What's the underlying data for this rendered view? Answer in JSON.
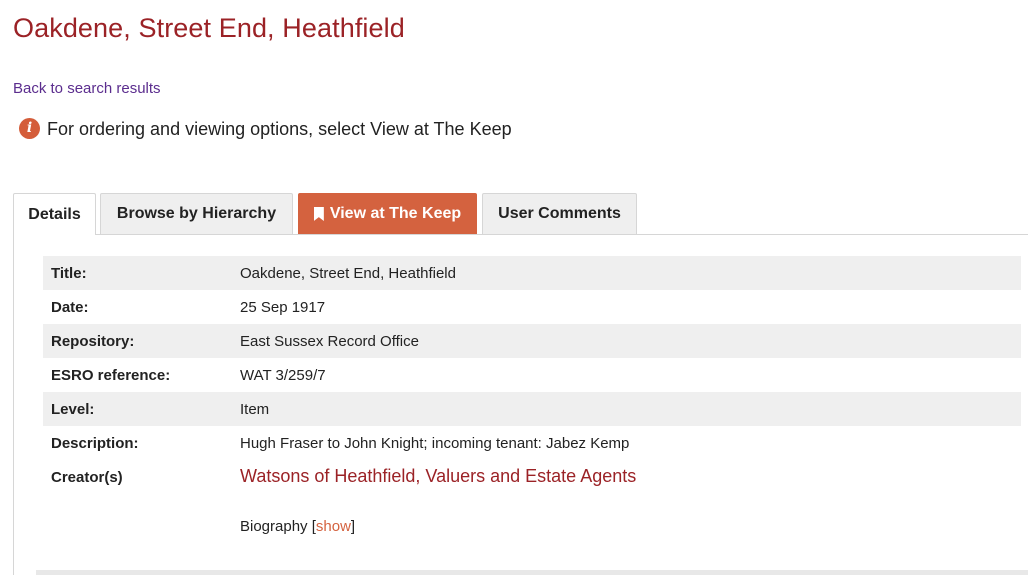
{
  "title": "Oakdene, Street End, Heathfield",
  "back_link": "Back to search results",
  "info": {
    "text": "For ordering and viewing options, select View at The Keep",
    "icon": "info-icon",
    "icon_color": "#d45d3a"
  },
  "tabs": [
    {
      "label": "Details",
      "active": true
    },
    {
      "label": "Browse by Hierarchy",
      "active": false
    },
    {
      "label": "View at The Keep",
      "active": false,
      "icon": "bookmark-icon",
      "color": "#d4623f"
    },
    {
      "label": "User Comments",
      "active": false
    }
  ],
  "details": [
    {
      "label": "Title:",
      "value": "Oakdene, Street End, Heathfield"
    },
    {
      "label": "Date:",
      "value": "25 Sep 1917"
    },
    {
      "label": "Repository:",
      "value": "East Sussex Record Office"
    },
    {
      "label": "ESRO reference:",
      "value": "WAT 3/259/7"
    },
    {
      "label": "Level:",
      "value": "Item"
    },
    {
      "label": "Description:",
      "value": "Hugh Fraser to John Knight; incoming tenant: Jabez Kemp"
    }
  ],
  "creator": {
    "label": "Creator(s)",
    "name": "Watsons of Heathfield, Valuers and Estate Agents",
    "bio_label": "Biography",
    "bio_open": "[",
    "bio_link": "show",
    "bio_close": "]"
  },
  "colors": {
    "title": "#9b2226",
    "accent": "#d4623f",
    "link": "#5b2d8e"
  }
}
